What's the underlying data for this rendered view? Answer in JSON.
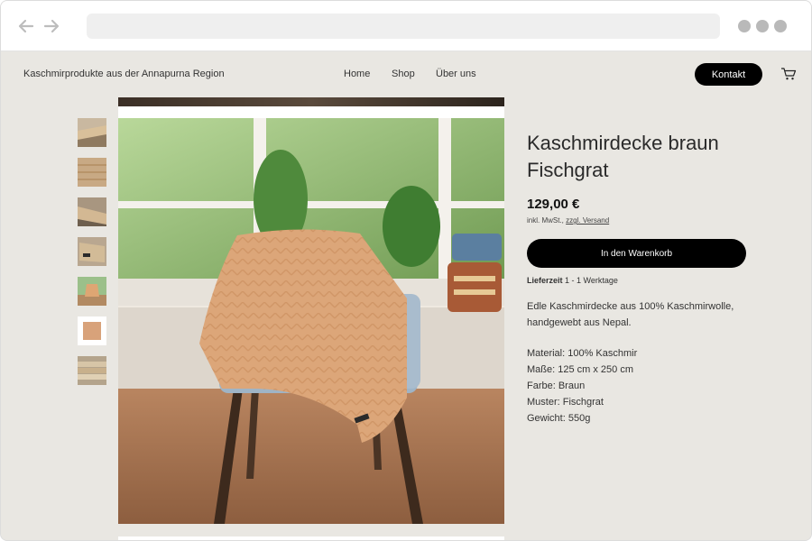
{
  "header": {
    "brand": "Kaschmirprodukte aus der Annapurna Region",
    "menu": [
      "Home",
      "Shop",
      "Über uns"
    ],
    "contact_label": "Kontakt"
  },
  "product": {
    "title": "Kaschmirdecke braun Fischgrat",
    "price": "129,00 €",
    "vat_prefix": "inkl. MwSt.,",
    "shipping_link": "zzgl. Versand",
    "add_to_cart": "In den Warenkorb",
    "delivery_label": "Lieferzeit",
    "delivery_value": "1 - 1 Werktage",
    "description_line1": "Edle Kaschmirdecke aus 100% Kaschmirwolle,",
    "description_line2": "handgewebt aus Nepal.",
    "specs": [
      "Material: 100% Kaschmir",
      "Maße: 125 cm x 250 cm",
      "Farbe: Braun",
      "Muster: Fischgrat",
      "Gewicht: 550g"
    ]
  },
  "colors": {
    "page_bg": "#e9e7e2",
    "button_bg": "#000000",
    "blanket": "#d9a377"
  },
  "icons": [
    "back-arrow-icon",
    "forward-arrow-icon",
    "cart-icon"
  ]
}
